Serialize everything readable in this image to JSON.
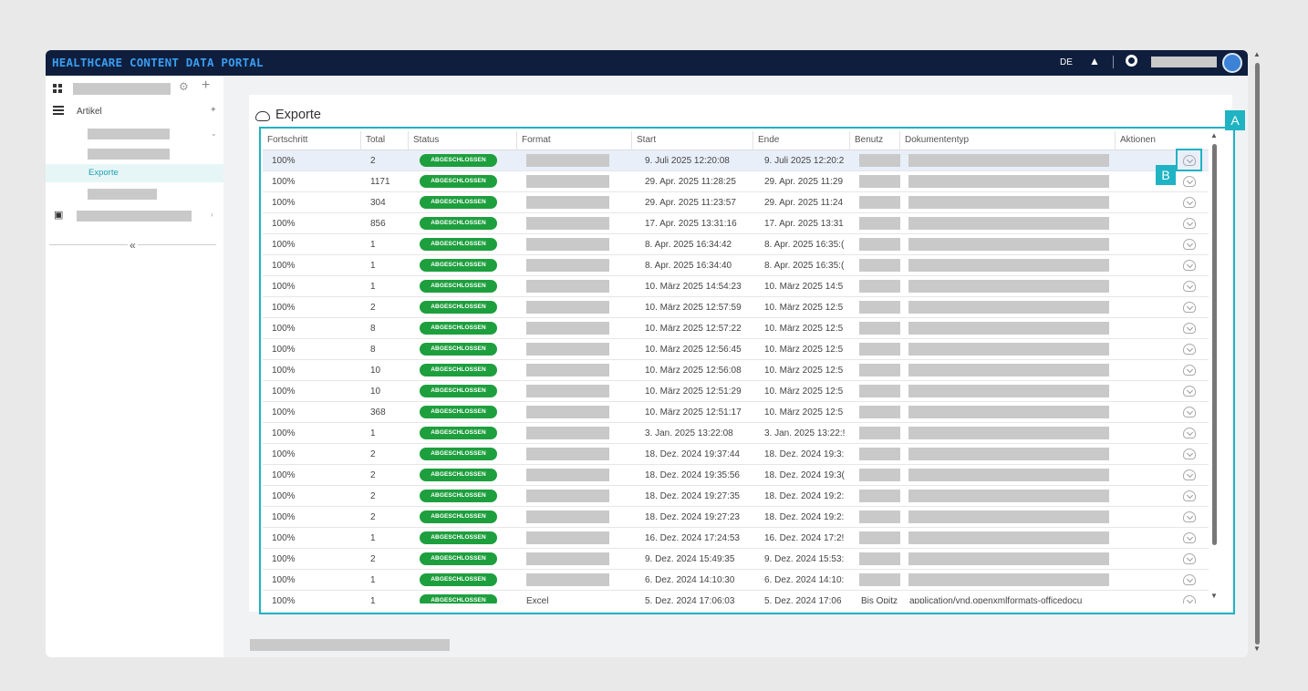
{
  "topbar": {
    "brand": "HEALTHCARE CONTENT DATA PORTAL",
    "language": "DE"
  },
  "sidebar": {
    "articles_label": "Artikel",
    "exports_label": "Exporte",
    "collapse_label": "«"
  },
  "page": {
    "title": "Exporte"
  },
  "table": {
    "columns": [
      "Fortschritt",
      "Total",
      "Status",
      "Format",
      "Start",
      "Ende",
      "Benutz",
      "Dokumententyp",
      "Aktionen"
    ],
    "rows": [
      {
        "progress": "100%",
        "total": "2",
        "status": "ABGESCHLOSSEN",
        "start": "9. Juli 2025 12:20:08",
        "end": "9. Juli 2025 12:20:2"
      },
      {
        "progress": "100%",
        "total": "1171",
        "status": "ABGESCHLOSSEN",
        "start": "29. Apr. 2025 11:28:25",
        "end": "29. Apr. 2025 11:29"
      },
      {
        "progress": "100%",
        "total": "304",
        "status": "ABGESCHLOSSEN",
        "start": "29. Apr. 2025 11:23:57",
        "end": "29. Apr. 2025 11:24"
      },
      {
        "progress": "100%",
        "total": "856",
        "status": "ABGESCHLOSSEN",
        "start": "17. Apr. 2025 13:31:16",
        "end": "17. Apr. 2025 13:31"
      },
      {
        "progress": "100%",
        "total": "1",
        "status": "ABGESCHLOSSEN",
        "start": "8. Apr. 2025 16:34:42",
        "end": "8. Apr. 2025 16:35:("
      },
      {
        "progress": "100%",
        "total": "1",
        "status": "ABGESCHLOSSEN",
        "start": "8. Apr. 2025 16:34:40",
        "end": "8. Apr. 2025 16:35:("
      },
      {
        "progress": "100%",
        "total": "1",
        "status": "ABGESCHLOSSEN",
        "start": "10. März 2025 14:54:23",
        "end": "10. März 2025 14:5"
      },
      {
        "progress": "100%",
        "total": "2",
        "status": "ABGESCHLOSSEN",
        "start": "10. März 2025 12:57:59",
        "end": "10. März 2025 12:5"
      },
      {
        "progress": "100%",
        "total": "8",
        "status": "ABGESCHLOSSEN",
        "start": "10. März 2025 12:57:22",
        "end": "10. März 2025 12:5"
      },
      {
        "progress": "100%",
        "total": "8",
        "status": "ABGESCHLOSSEN",
        "start": "10. März 2025 12:56:45",
        "end": "10. März 2025 12:5"
      },
      {
        "progress": "100%",
        "total": "10",
        "status": "ABGESCHLOSSEN",
        "start": "10. März 2025 12:56:08",
        "end": "10. März 2025 12:5"
      },
      {
        "progress": "100%",
        "total": "10",
        "status": "ABGESCHLOSSEN",
        "start": "10. März 2025 12:51:29",
        "end": "10. März 2025 12:5"
      },
      {
        "progress": "100%",
        "total": "368",
        "status": "ABGESCHLOSSEN",
        "start": "10. März 2025 12:51:17",
        "end": "10. März 2025 12:5"
      },
      {
        "progress": "100%",
        "total": "1",
        "status": "ABGESCHLOSSEN",
        "start": "3. Jan. 2025 13:22:08",
        "end": "3. Jan. 2025 13:22:!"
      },
      {
        "progress": "100%",
        "total": "2",
        "status": "ABGESCHLOSSEN",
        "start": "18. Dez. 2024 19:37:44",
        "end": "18. Dez. 2024 19:3:"
      },
      {
        "progress": "100%",
        "total": "2",
        "status": "ABGESCHLOSSEN",
        "start": "18. Dez. 2024 19:35:56",
        "end": "18. Dez. 2024 19:3("
      },
      {
        "progress": "100%",
        "total": "2",
        "status": "ABGESCHLOSSEN",
        "start": "18. Dez. 2024 19:27:35",
        "end": "18. Dez. 2024 19:2:"
      },
      {
        "progress": "100%",
        "total": "2",
        "status": "ABGESCHLOSSEN",
        "start": "18. Dez. 2024 19:27:23",
        "end": "18. Dez. 2024 19:2:"
      },
      {
        "progress": "100%",
        "total": "1",
        "status": "ABGESCHLOSSEN",
        "start": "16. Dez. 2024 17:24:53",
        "end": "16. Dez. 2024 17:2!"
      },
      {
        "progress": "100%",
        "total": "2",
        "status": "ABGESCHLOSSEN",
        "start": "9. Dez. 2024 15:49:35",
        "end": "9. Dez. 2024 15:53:"
      },
      {
        "progress": "100%",
        "total": "1",
        "status": "ABGESCHLOSSEN",
        "start": "6. Dez. 2024 14:10:30",
        "end": "6. Dez. 2024 14:10:"
      },
      {
        "progress": "100%",
        "total": "1",
        "status": "ABGESCHLOSSEN",
        "format": "Excel",
        "start": "5. Dez. 2024 17:06:03",
        "end": "5. Dez. 2024 17:06",
        "user": "Bis Opitz",
        "doctype": "application/vnd.openxmlformats-officedocu"
      }
    ]
  },
  "annotations": {
    "a": "A",
    "b": "B"
  },
  "colors": {
    "topbar": "#0f1e3d",
    "brand": "#3a9df0",
    "status_ok": "#1e9f3e",
    "highlight": "#1fb3c3",
    "active_nav": "#1f9fb3"
  }
}
